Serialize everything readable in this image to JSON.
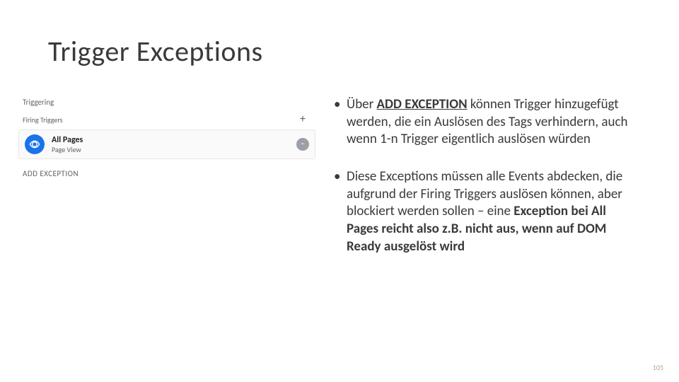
{
  "title": "Trigger Exceptions",
  "panel": {
    "sectionLabel": "Triggering",
    "subLabel": "Firing Triggers",
    "trigger": {
      "name": "All Pages",
      "type": "Page View"
    },
    "addException": "ADD EXCEPTION"
  },
  "bullets": {
    "b1_pre": "Über ",
    "b1_ul": "ADD EXCEPTION",
    "b1_post": " können Trigger hinzugefügt werden, die ein Auslösen des Tags verhindern, auch wenn 1-n Trigger eigentlich auslösen würden",
    "b2_pre": "Diese Exceptions müssen alle Events abdecken, die aufgrund der Firing Triggers auslösen können, aber blockiert werden sollen – eine ",
    "b2_bold": "Exception bei All Pages reicht also z.B. nicht aus, wenn auf DOM Ready ausgelöst wird"
  },
  "pageNumber": "105"
}
